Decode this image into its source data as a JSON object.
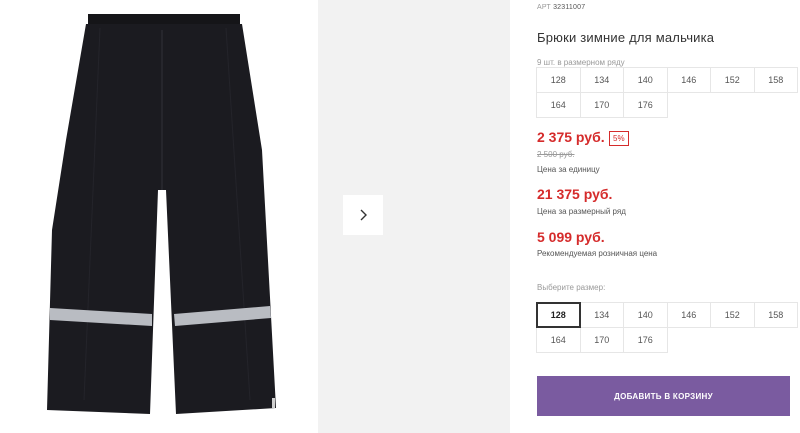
{
  "product": {
    "sku_label": "АРТ",
    "sku_value": "32311007",
    "title": "Брюки зимние для мальчика",
    "pack_label": "9 шт. в размерном ряду",
    "pack_sizes": [
      "128",
      "134",
      "140",
      "146",
      "152",
      "158",
      "164",
      "170",
      "176"
    ]
  },
  "pricing": {
    "unit_price": "2 375 руб.",
    "discount": "5%",
    "old_price": "2 500 руб.",
    "unit_caption": "Цена за единицу",
    "pack_price": "21 375 руб.",
    "pack_caption": "Цена за размерный ряд",
    "retail_price": "5 099 руб.",
    "retail_caption": "Рекомендуемая розничная цена"
  },
  "size_select": {
    "label": "Выберите размер:",
    "sizes": [
      "128",
      "134",
      "140",
      "146",
      "152",
      "158",
      "164",
      "170",
      "176"
    ],
    "selected": "128"
  },
  "actions": {
    "add_to_cart": "ДОБАВИТЬ В КОРЗИНУ"
  },
  "colors": {
    "price_red": "#d52b2b",
    "button_purple": "#7a5ba0"
  },
  "icons": {
    "next": "chevron-right-icon"
  }
}
